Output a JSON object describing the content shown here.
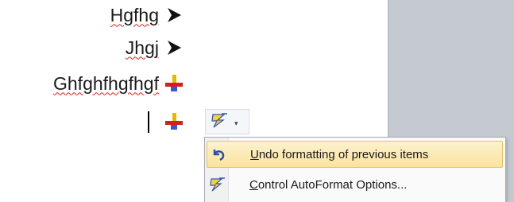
{
  "document": {
    "list_items": [
      {
        "text": "Hgfhg",
        "bullet": "arrowhead-bullet-icon"
      },
      {
        "text": "Jhgj",
        "bullet": "arrowhead-bullet-icon"
      },
      {
        "text": "Ghfghfhgfhgf",
        "bullet": "colored-cross-bullet-icon"
      },
      {
        "text": "",
        "bullet": "colored-cross-bullet-icon"
      }
    ]
  },
  "autocorrect_button": {
    "icon": "autoformat-lightning-icon",
    "arrow": "▾"
  },
  "menu": {
    "items": [
      {
        "accel": "U",
        "rest": "ndo formatting of previous items",
        "icon": "undo-icon",
        "highlighted": true
      },
      {
        "accel": "C",
        "rest": "ontrol AutoFormat Options...",
        "icon": "autoformat-options-icon",
        "highlighted": false
      }
    ]
  },
  "colors": {
    "menu_highlight": "#fbe39e",
    "spellcheck_underline": "#e02020",
    "app_gutter": "#c5cad1"
  }
}
